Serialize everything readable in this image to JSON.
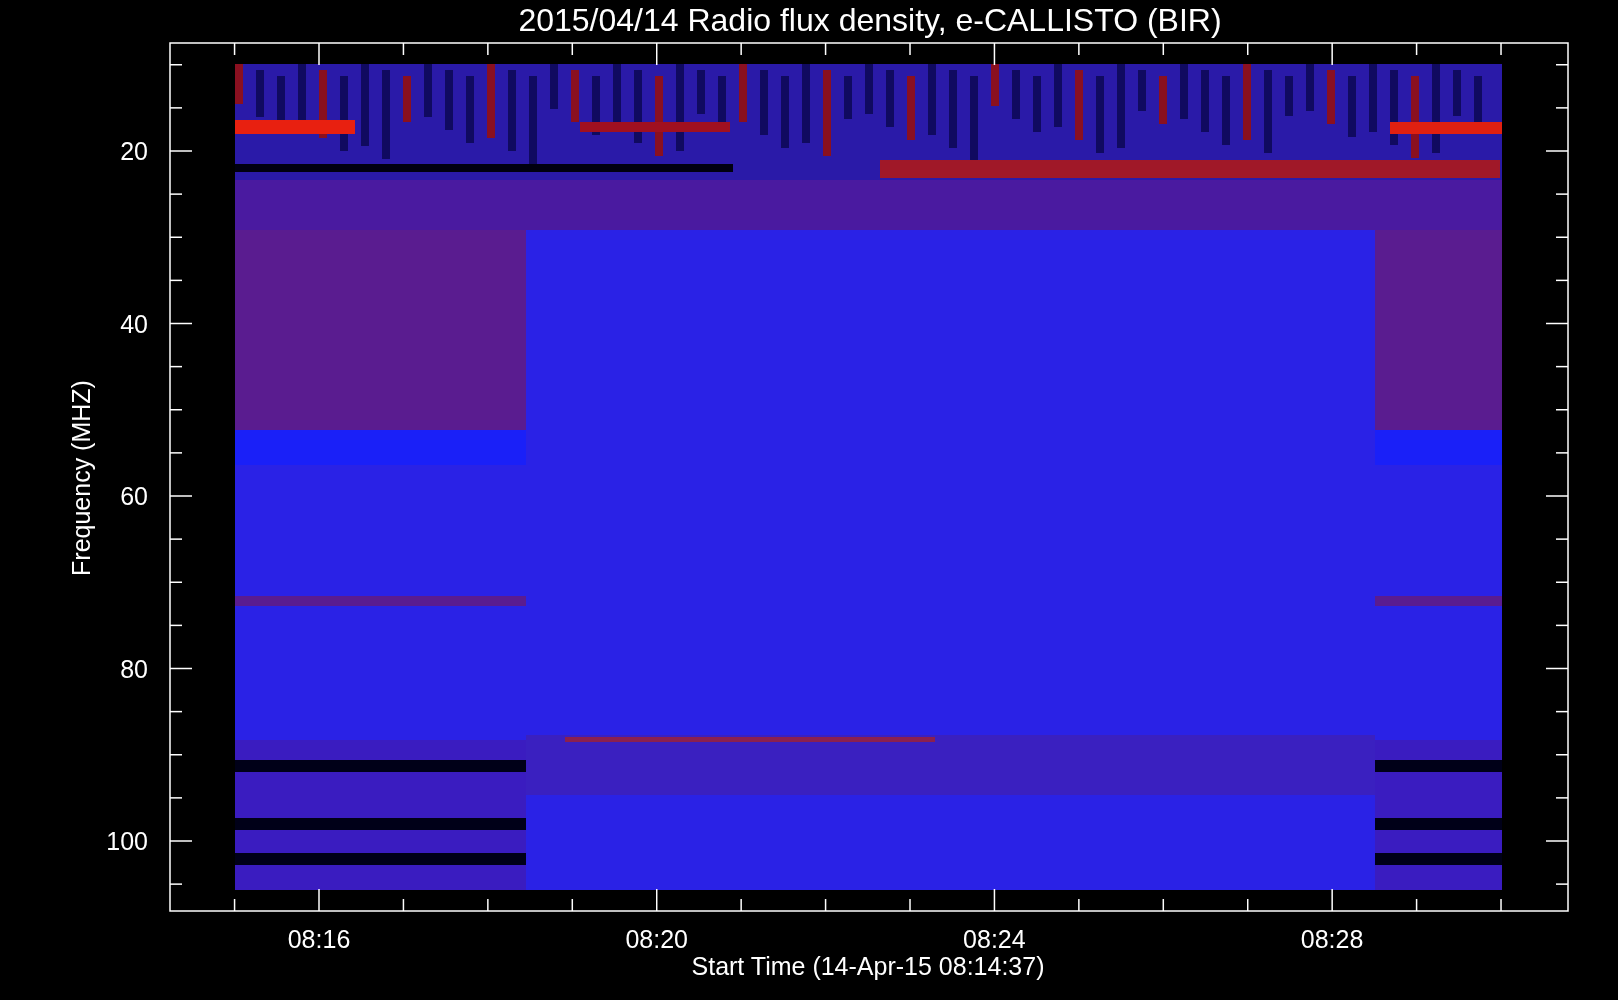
{
  "title": "2015/04/14  Radio flux density, e-CALLISTO (BIR)",
  "y_axis": {
    "label": "Frequency (MHZ)",
    "ticks": [
      "20",
      "40",
      "60",
      "80",
      "100"
    ]
  },
  "x_axis": {
    "label": "Start Time (14-Apr-15 08:14:37)",
    "ticks": [
      "08:16",
      "08:20",
      "08:24",
      "08:28"
    ]
  }
}
